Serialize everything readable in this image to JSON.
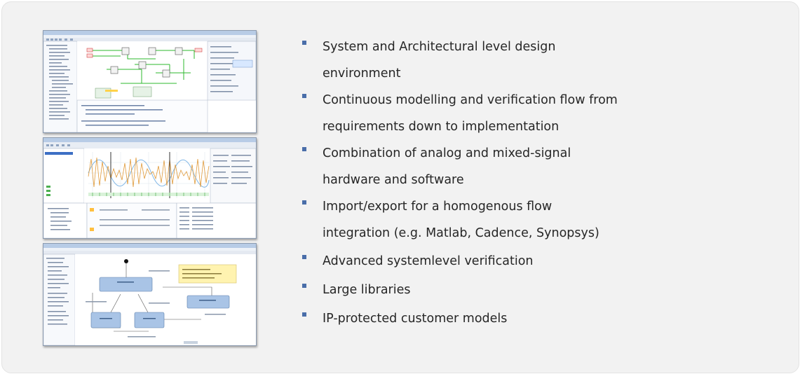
{
  "bullets": [
    {
      "lines": [
        "System and Architectural level design",
        "environment"
      ]
    },
    {
      "lines": [
        "Continuous modelling and verification flow from",
        "requirements down to implementation"
      ]
    },
    {
      "lines": [
        "Combination of analog and mixed-signal",
        "hardware and software"
      ]
    },
    {
      "lines": [
        "Import/export for a homogenous flow",
        "integration (e.g. Matlab, Cadence, Synopsys)"
      ]
    },
    {
      "lines": [
        "Advanced systemlevel verification"
      ]
    },
    {
      "lines": [
        "Large libraries"
      ]
    },
    {
      "lines": [
        "IP-protected customer models"
      ]
    }
  ],
  "colors": {
    "panel_bg": "#f2f2f2",
    "bullet_marker": "#4a6ea9",
    "text": "#262626",
    "window_chrome": "#c9d9ee"
  },
  "screenshots": [
    {
      "name": "schematic-editor-screenshot"
    },
    {
      "name": "waveform-viewer-screenshot"
    },
    {
      "name": "state-machine-editor-screenshot"
    }
  ]
}
